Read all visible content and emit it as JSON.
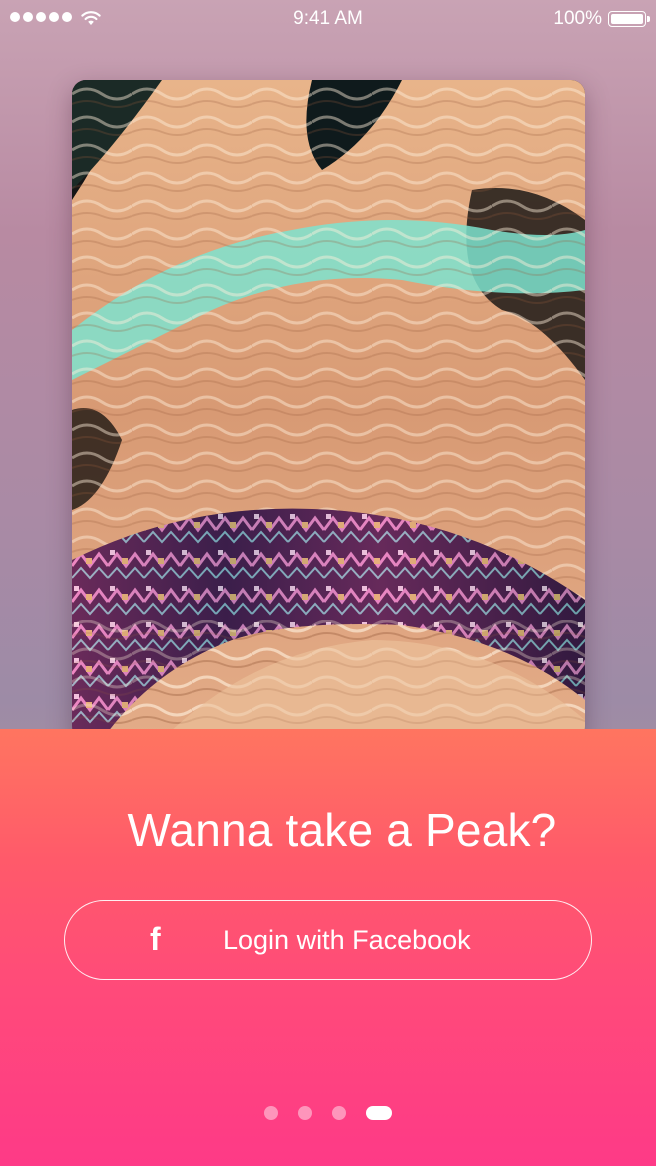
{
  "status_bar": {
    "time": "9:41 AM",
    "battery_percent": "100%",
    "battery_level": 1.0,
    "signal_icon": "signal-dots-icon",
    "wifi_icon": "wifi-icon",
    "battery_icon": "battery-icon"
  },
  "photo": {
    "subject": "swimmer-underwater-photo"
  },
  "onboarding": {
    "headline": "Wanna take a Peak?",
    "facebook_icon_glyph": "f",
    "facebook_icon": "facebook-icon",
    "login_button_label": "Login with Facebook",
    "pages": 4,
    "active_page": 4
  },
  "colors": {
    "panel_top": "#ff7560",
    "panel_bottom": "#fe3a87",
    "background": "#b88aa2",
    "text": "#ffffff"
  }
}
